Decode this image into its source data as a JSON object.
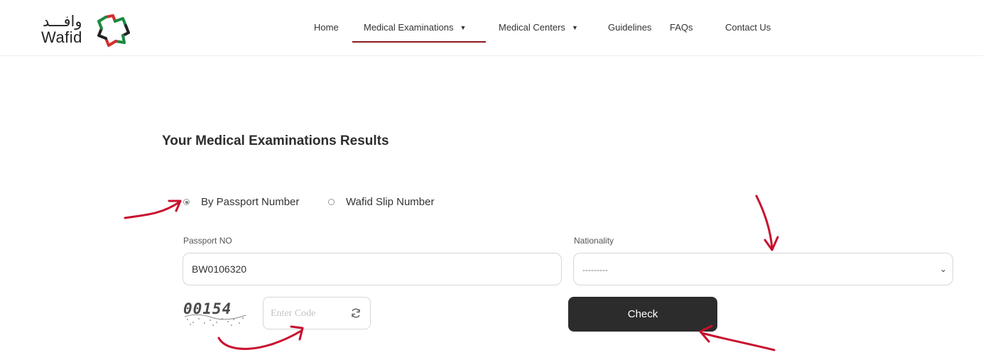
{
  "header": {
    "logo": {
      "arabic": "وافـــد",
      "english": "Wafid"
    },
    "nav": [
      {
        "label": "Home",
        "has_dropdown": false,
        "active": false
      },
      {
        "label": "Medical Examinations",
        "has_dropdown": true,
        "active": true
      },
      {
        "label": "Medical Centers",
        "has_dropdown": true,
        "active": false
      },
      {
        "label": "Guidelines",
        "has_dropdown": false,
        "active": false
      },
      {
        "label": "FAQs",
        "has_dropdown": false,
        "active": false
      },
      {
        "label": "Contact Us",
        "has_dropdown": false,
        "active": false
      }
    ]
  },
  "main": {
    "title": "Your Medical Examinations Results",
    "search_by": {
      "options": [
        {
          "label": "By Passport Number",
          "selected": true
        },
        {
          "label": "Wafid Slip Number",
          "selected": false
        }
      ]
    },
    "passport": {
      "label": "Passport NO",
      "value": "BW0106320"
    },
    "nationality": {
      "label": "Nationality",
      "value": "---------"
    },
    "captcha": {
      "text": "00154"
    },
    "code_input": {
      "placeholder": "Enter Code",
      "value": ""
    },
    "check_button": {
      "label": "Check"
    }
  },
  "colors": {
    "accent_underline": "#8b1a1a",
    "button_bg": "#2c2c2c",
    "annotation_arrow": "#c8102e",
    "logo_red": "#d32f2f",
    "logo_green": "#1b8a3e",
    "logo_black": "#222222"
  },
  "icons": {
    "logo_mark": "wafid-star-icon",
    "refresh": "refresh-icon",
    "select_arrow": "chevron-down-icon",
    "nav_caret": "caret-down-icon",
    "annotation": "hand-drawn-arrow-icon"
  }
}
